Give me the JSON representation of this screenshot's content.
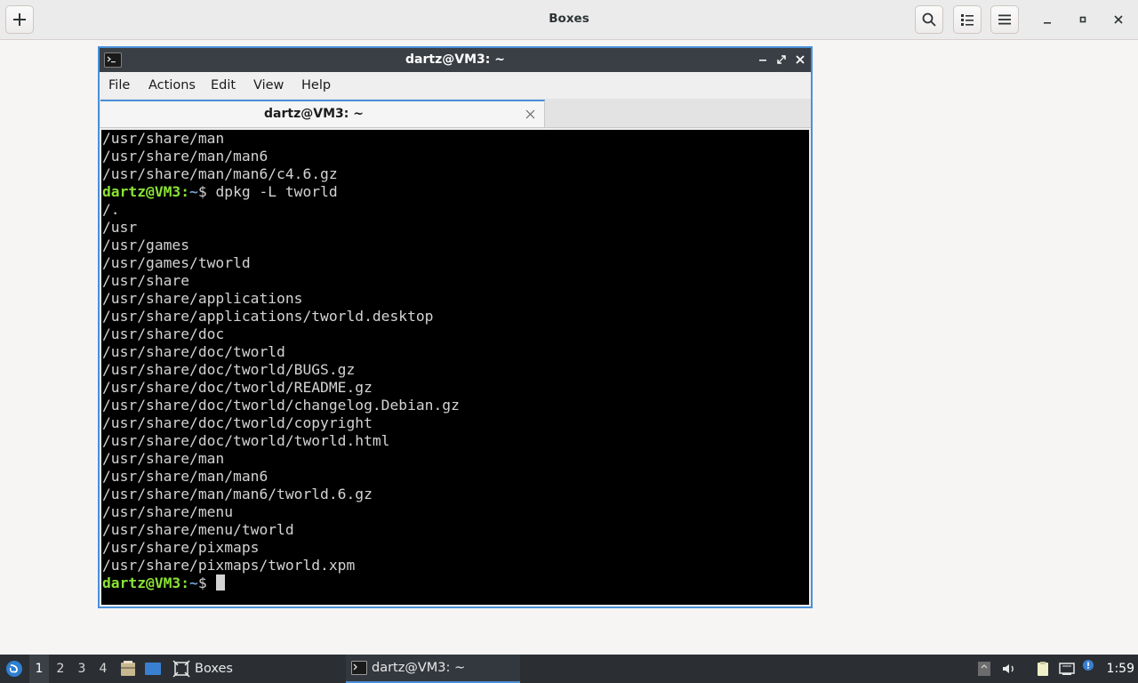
{
  "header": {
    "title": "Boxes",
    "new_icon": "plus-icon",
    "search_icon": "search-icon",
    "view_icon": "list-view-icon",
    "menu_icon": "hamburger-menu-icon"
  },
  "terminal": {
    "title": "dartz@VM3: ~",
    "menu": [
      "File",
      "Actions",
      "Edit",
      "View",
      "Help"
    ],
    "tab_label": "dartz@VM3: ~",
    "lines": [
      {
        "type": "out",
        "text": "/usr/share/man"
      },
      {
        "type": "out",
        "text": "/usr/share/man/man6"
      },
      {
        "type": "out",
        "text": "/usr/share/man/man6/c4.6.gz"
      },
      {
        "type": "prompt",
        "user": "dartz@VM3",
        "path": "~",
        "cmd": "dpkg -L tworld"
      },
      {
        "type": "out",
        "text": "/."
      },
      {
        "type": "out",
        "text": "/usr"
      },
      {
        "type": "out",
        "text": "/usr/games"
      },
      {
        "type": "out",
        "text": "/usr/games/tworld"
      },
      {
        "type": "out",
        "text": "/usr/share"
      },
      {
        "type": "out",
        "text": "/usr/share/applications"
      },
      {
        "type": "out",
        "text": "/usr/share/applications/tworld.desktop"
      },
      {
        "type": "out",
        "text": "/usr/share/doc"
      },
      {
        "type": "out",
        "text": "/usr/share/doc/tworld"
      },
      {
        "type": "out",
        "text": "/usr/share/doc/tworld/BUGS.gz"
      },
      {
        "type": "out",
        "text": "/usr/share/doc/tworld/README.gz"
      },
      {
        "type": "out",
        "text": "/usr/share/doc/tworld/changelog.Debian.gz"
      },
      {
        "type": "out",
        "text": "/usr/share/doc/tworld/copyright"
      },
      {
        "type": "out",
        "text": "/usr/share/doc/tworld/tworld.html"
      },
      {
        "type": "out",
        "text": "/usr/share/man"
      },
      {
        "type": "out",
        "text": "/usr/share/man/man6"
      },
      {
        "type": "out",
        "text": "/usr/share/man/man6/tworld.6.gz"
      },
      {
        "type": "out",
        "text": "/usr/share/menu"
      },
      {
        "type": "out",
        "text": "/usr/share/menu/tworld"
      },
      {
        "type": "out",
        "text": "/usr/share/pixmaps"
      },
      {
        "type": "out",
        "text": "/usr/share/pixmaps/tworld.xpm"
      },
      {
        "type": "prompt",
        "user": "dartz@VM3",
        "path": "~",
        "cmd": "",
        "cursor": true
      }
    ]
  },
  "panel": {
    "workspaces": [
      "1",
      "2",
      "3",
      "4"
    ],
    "active_workspace": "1",
    "tasks": [
      {
        "label": "Boxes",
        "icon": "boxes-icon"
      },
      {
        "label": "dartz@VM3: ~",
        "icon": "terminal-icon",
        "active": true
      }
    ],
    "clock": "1:59",
    "colors": {
      "accent": "#4a90d9",
      "prompt_user": "#8ae234",
      "prompt_path": "#729fcf"
    }
  }
}
